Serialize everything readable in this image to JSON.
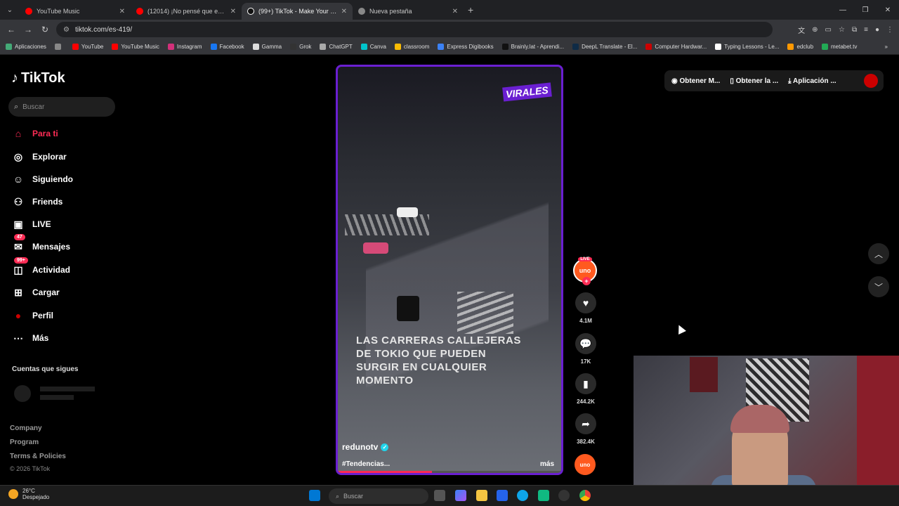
{
  "browser": {
    "tabs": [
      {
        "title": "YouTube Music",
        "color": "#ff0000"
      },
      {
        "title": "(12014) ¡No pensé que esto pa...",
        "color": "#ff0000"
      },
      {
        "title": "(99+) TikTok - Make Your Day",
        "color": "#000000"
      },
      {
        "title": "Nueva pestaña",
        "color": "#888888"
      }
    ],
    "url": "tiktok.com/es-419/",
    "bookmarks": [
      "Aplicaciones",
      "YouTube",
      "YouTube Music",
      "Instagram",
      "Facebook",
      "Gamma",
      "Grok",
      "ChatGPT",
      "Canva",
      "classroom",
      "Express Digibooks",
      "Brainly.lat - Aprendi...",
      "DeepL Translate - El...",
      "Computer Hardwar...",
      "Typing Lessons - Le...",
      "edclub",
      "metabet.tv"
    ]
  },
  "sidebar": {
    "logo": "TikTok",
    "search_placeholder": "Buscar",
    "items": [
      {
        "label": "Para ti",
        "icon": "home-icon",
        "glyph": "⌂"
      },
      {
        "label": "Explorar",
        "icon": "compass-icon",
        "glyph": "◎"
      },
      {
        "label": "Siguiendo",
        "icon": "following-icon",
        "glyph": "☺"
      },
      {
        "label": "Friends",
        "icon": "friends-icon",
        "glyph": "⚇"
      },
      {
        "label": "LIVE",
        "icon": "live-icon",
        "glyph": "▣"
      },
      {
        "label": "Mensajes",
        "icon": "messages-icon",
        "glyph": "✉",
        "badge": "47"
      },
      {
        "label": "Actividad",
        "icon": "activity-icon",
        "glyph": "◫",
        "badge": "99+"
      },
      {
        "label": "Cargar",
        "icon": "upload-icon",
        "glyph": "⊞"
      },
      {
        "label": "Perfil",
        "icon": "profile-icon",
        "glyph": "●"
      },
      {
        "label": "Más",
        "icon": "more-icon",
        "glyph": "⋯"
      }
    ],
    "following_title": "Cuentas que sigues",
    "footer": [
      "Company",
      "Program",
      "Terms & Policies"
    ],
    "copyright": "© 2026 TikTok"
  },
  "video": {
    "badge": "VIRALES",
    "caption": "LAS CARRERAS CALLEJERAS DE TOKIO QUE PUEDEN SURGIR EN CUALQUIER MOMENTO",
    "author": "redunotv",
    "tags": "#Tendencias...",
    "more": "más",
    "progress": 0.42
  },
  "actions": {
    "live_label": "LIVE",
    "avatar_text": "uno",
    "likes": "4.1M",
    "comments": "17K",
    "saves": "244.2K",
    "shares": "382.4K"
  },
  "topbar": {
    "get_coins": "Obtener M...",
    "get_app": "Obtener la ...",
    "desktop_app": "Aplicación ..."
  },
  "taskbar": {
    "temp": "26°C",
    "weather": "Despejado",
    "search": "Buscar"
  }
}
